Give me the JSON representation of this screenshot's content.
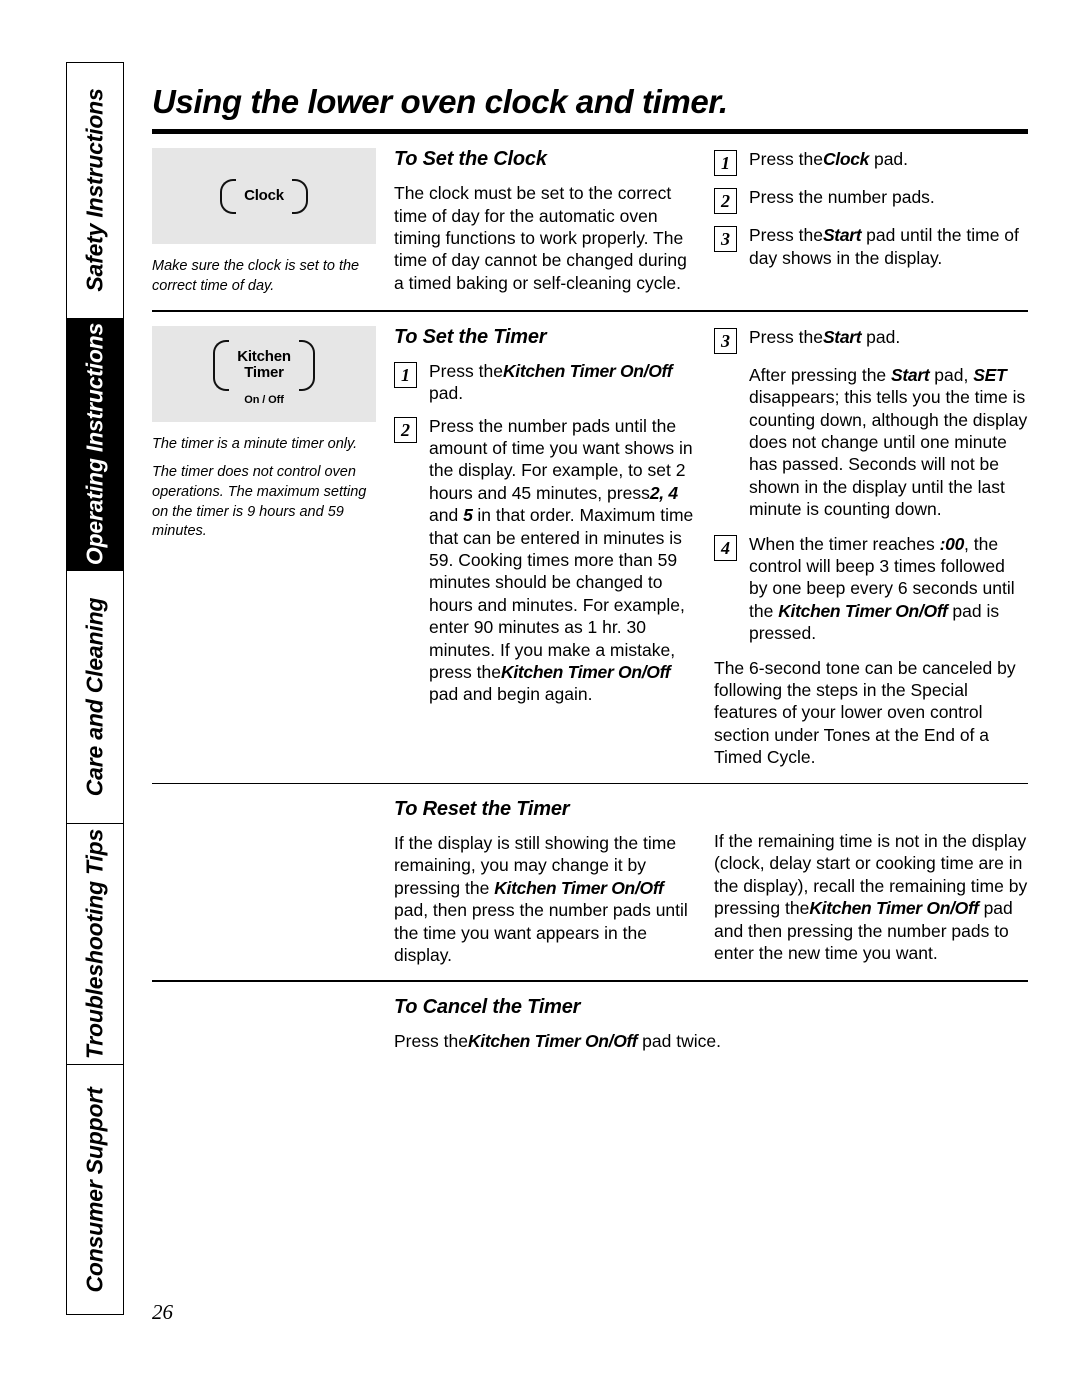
{
  "page": {
    "title": "Using the lower oven clock and timer.",
    "number": "26"
  },
  "sidebar": {
    "tabs": [
      {
        "label": "Safety Instructions",
        "active": false
      },
      {
        "label": "Operating Instructions",
        "active": true
      },
      {
        "label": "Care and Cleaning",
        "active": false
      },
      {
        "label": "Troubleshooting Tips",
        "active": false
      },
      {
        "label": "Consumer Support",
        "active": false
      }
    ]
  },
  "sections": {
    "set_clock": {
      "heading": "To Set the Clock",
      "art": {
        "pad_label": "Clock",
        "pad_sublabel": ""
      },
      "notes": [
        "Make sure the clock is set to the correct time of day."
      ],
      "intro": "The clock must be set to the correct time of day for the automatic oven timing functions to work properly. The time of day cannot be changed during a timed baking or self-cleaning cycle.",
      "steps": [
        {
          "num": "1",
          "pre": "Press the",
          "bold": "Clock",
          "post": " pad."
        },
        {
          "num": "2",
          "pre": "Press the number pads.",
          "bold": "",
          "post": ""
        },
        {
          "num": "3",
          "pre": "Press the",
          "bold": "Start",
          "post": " pad until the time of day shows in the display."
        }
      ]
    },
    "set_timer": {
      "heading": "To Set the Timer",
      "art": {
        "pad_label_line1": "Kitchen",
        "pad_label_line2": "Timer",
        "pad_sublabel": "On / Off"
      },
      "notes": [
        "The timer is a minute timer only.",
        "The timer does not control oven operations. The maximum setting on the timer is 9 hours and 59 minutes."
      ],
      "step1": {
        "num": "1",
        "pre": "Press the",
        "bold": "Kitchen Timer On/Off",
        "post": " pad."
      },
      "step2": {
        "num": "2",
        "part1": "Press the number pads until the amount of time you want shows in the display.  For example, to set 2 hours and 45 minutes, press",
        "bold1": "2, 4",
        "part2": " and ",
        "bold2": "5",
        "part3": " in that order. Maximum time that can be entered in minutes is 59. Cooking times more than 59 minutes should be changed to hours and minutes. For example, enter 90 minutes as 1 hr. 30 minutes. If you make a mistake, press the",
        "bold3": "Kitchen Timer On/Off",
        "part4": " pad and begin again."
      },
      "step3": {
        "num": "3",
        "pre": "Press the",
        "bold": "Start",
        "post": " pad."
      },
      "step3_cont": {
        "part1": "After pressing the ",
        "bold1": "Start",
        "part2": " pad, ",
        "bold2": "SET",
        "part3": " disappears; this tells you the time is counting down, although the display does not change until one minute has passed. Seconds will not be shown in the display until the last minute is counting down."
      },
      "step4": {
        "num": "4",
        "part1": "When the timer reaches ",
        "bold1": ":00",
        "part2": ", the control will beep 3 times followed by one beep every 6 seconds until the ",
        "bold2": "Kitchen Timer On/Off",
        "part3": " pad is pressed."
      },
      "closing": "The 6-second tone can be canceled by following the steps in the Special features of your lower oven control section under Tones at the End of a Timed Cycle."
    },
    "reset_timer": {
      "heading": "To Reset the Timer",
      "left": {
        "part1": "If the display is still showing the time remaining, you may change it by pressing the ",
        "bold1": "Kitchen Timer On/Off",
        "part2": " pad, then press the number pads until the time you want appears in the display."
      },
      "right": {
        "part1": "If the remaining time is not in the display (clock, delay start or cooking time are in the display), recall the remaining time by pressing the",
        "bold1": "Kitchen Timer On/Off",
        "part2": " pad and then pressing the number pads to enter the new time you want."
      }
    },
    "cancel_timer": {
      "heading": "To Cancel the Timer",
      "body": {
        "part1": "Press the",
        "bold1": "Kitchen Timer On/Off",
        "part2": " pad twice."
      }
    }
  }
}
